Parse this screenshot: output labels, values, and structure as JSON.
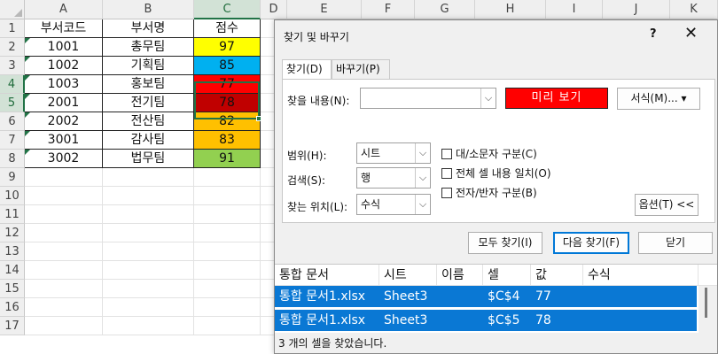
{
  "sheet": {
    "columns": [
      "A",
      "B",
      "C",
      "D",
      "E",
      "F",
      "G",
      "H",
      "I",
      "J",
      "K"
    ],
    "rows": [
      "1",
      "2",
      "3",
      "4",
      "5",
      "6",
      "7",
      "8",
      "9",
      "10",
      "11",
      "12",
      "13",
      "14",
      "15",
      "16",
      "17"
    ],
    "table": [
      [
        "부서코드",
        "부서명",
        "점수"
      ],
      [
        "1001",
        "총무팀",
        "97"
      ],
      [
        "1002",
        "기획팀",
        "85"
      ],
      [
        "1003",
        "홍보팀",
        "77"
      ],
      [
        "2001",
        "전기팀",
        "78"
      ],
      [
        "2002",
        "전산팀",
        "82"
      ],
      [
        "3001",
        "감사팀",
        "83"
      ],
      [
        "3002",
        "법무팀",
        "91"
      ]
    ],
    "score_colors": [
      "#ffff00",
      "#00b0f0",
      "#ff0000",
      "#c00000",
      "#ffc000",
      "#ffc000",
      "#92d050"
    ]
  },
  "dialog": {
    "title": "찾기 및 바꾸기",
    "help": "?",
    "close": "✕",
    "tabs": [
      "찾기(D)",
      "바꾸기(P)"
    ],
    "find_label": "찾을 내용(N):",
    "find_value": "",
    "preview_label": "미리 보기",
    "preview_color": "#ff0000",
    "format_button": "서식(M)...",
    "scope_label": "범위(H):",
    "scope_value": "시트",
    "search_label": "검색(S):",
    "search_value": "행",
    "lookin_label": "찾는 위치(L):",
    "lookin_value": "수식",
    "match_case": "대/소문자 구분(C)",
    "match_entire": "전체 셀 내용 일치(O)",
    "match_width": "전자/반자 구분(B)",
    "options_button": "옵션(T) <<",
    "find_all": "모두 찾기(I)",
    "find_next": "다음 찾기(F)",
    "close_button": "닫기",
    "results": {
      "headers": [
        "통합 문서",
        "시트",
        "이름",
        "셀",
        "값",
        "수식"
      ],
      "rows": [
        [
          "통합 문서1.xlsx",
          "Sheet3",
          "",
          "$C$4",
          "77",
          ""
        ],
        [
          "통합 문서1.xlsx",
          "Sheet3",
          "",
          "$C$5",
          "78",
          ""
        ]
      ]
    },
    "status": "3 개의 셀을 찾았습니다."
  }
}
